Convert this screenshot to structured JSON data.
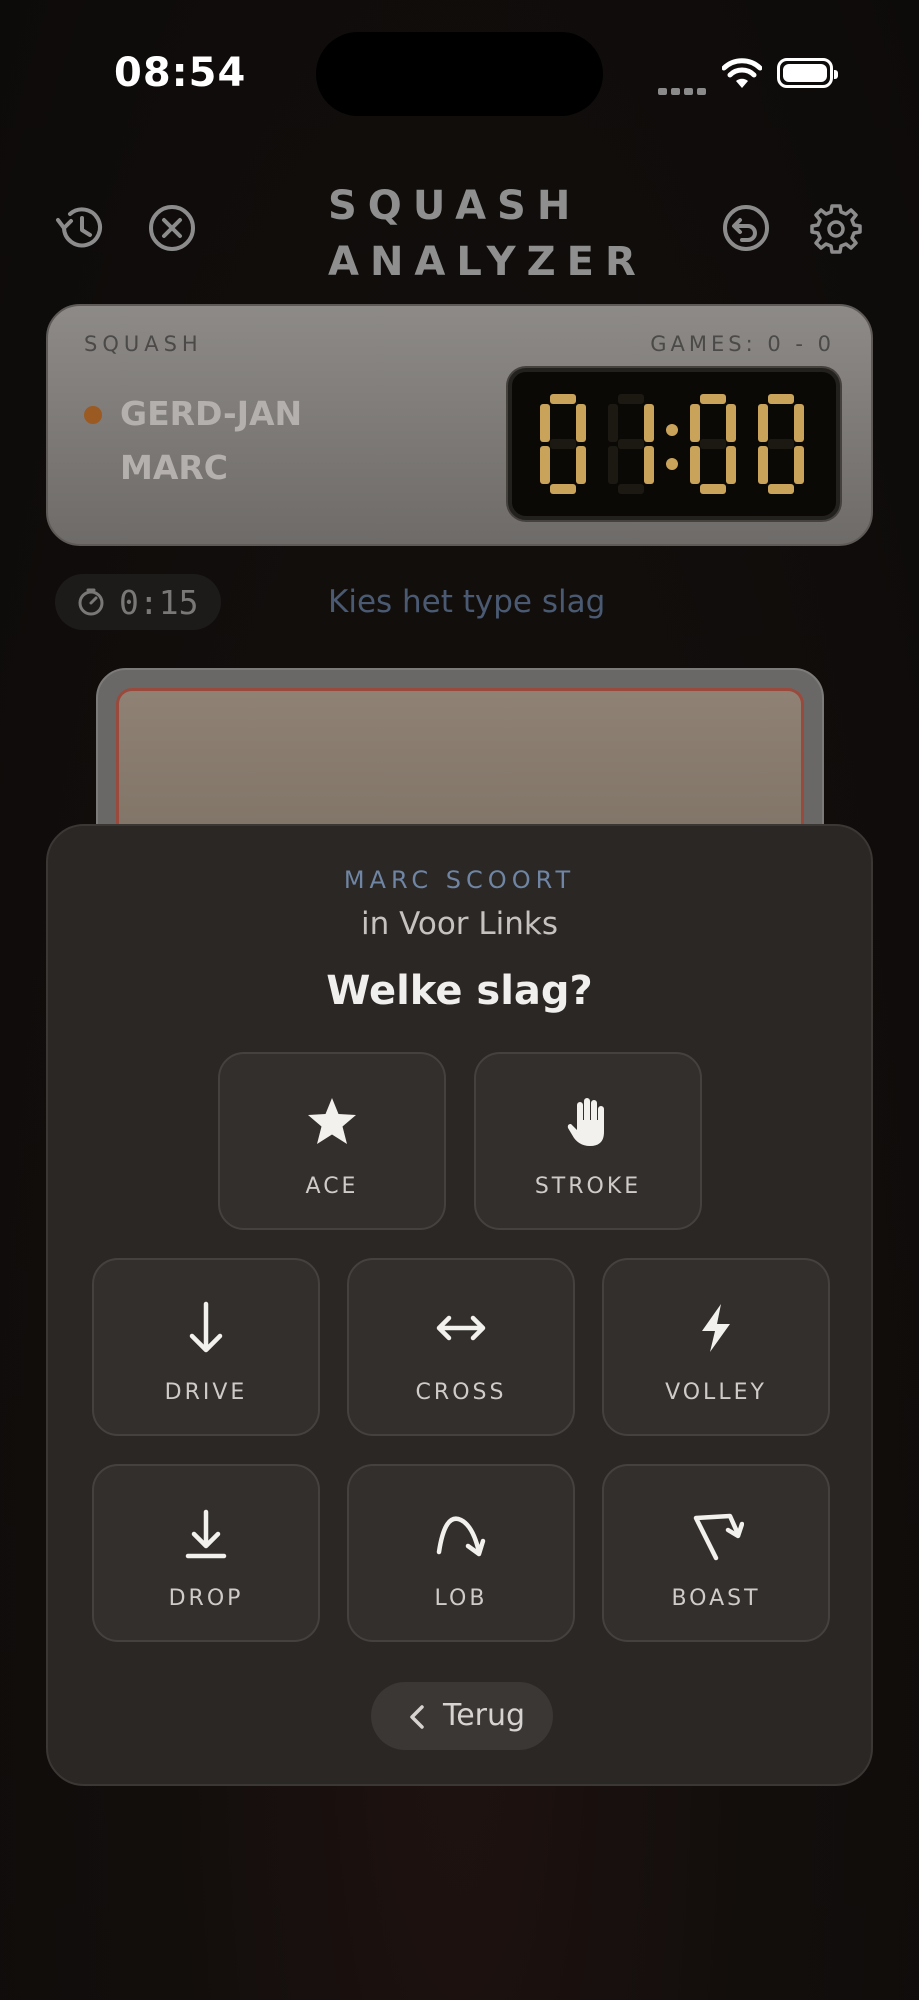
{
  "status": {
    "time": "08:54"
  },
  "header": {
    "title_line1": "SQUASH",
    "title_line2": "ANALYZER"
  },
  "scoreboard": {
    "label": "SQUASH",
    "games": "GAMES: 0 - 0",
    "player1": "GERD-JAN",
    "player2": "MARC",
    "serving_player": "GERD-JAN",
    "score_display": "01:00"
  },
  "rally": {
    "timer": "0:15",
    "hint": "Kies het type slag"
  },
  "sheet": {
    "scorer": "MARC SCOORT",
    "location": "in Voor Links",
    "question": "Welke slag?",
    "shots": [
      {
        "label": "ACE",
        "icon": "star-icon"
      },
      {
        "label": "STROKE",
        "icon": "hand-icon"
      },
      {
        "label": "DRIVE",
        "icon": "arrow-down-icon"
      },
      {
        "label": "CROSS",
        "icon": "arrow-left-right-icon"
      },
      {
        "label": "VOLLEY",
        "icon": "bolt-icon"
      },
      {
        "label": "DROP",
        "icon": "arrow-down-to-line-icon"
      },
      {
        "label": "LOB",
        "icon": "curved-arrow-icon"
      },
      {
        "label": "BOAST",
        "icon": "angled-arrow-icon"
      }
    ],
    "back_label": "Terug"
  },
  "colors": {
    "serve_indicator": "#9a5a22",
    "lcd_digit": "#c9a35a",
    "accent_blue": "#6f85a3"
  }
}
